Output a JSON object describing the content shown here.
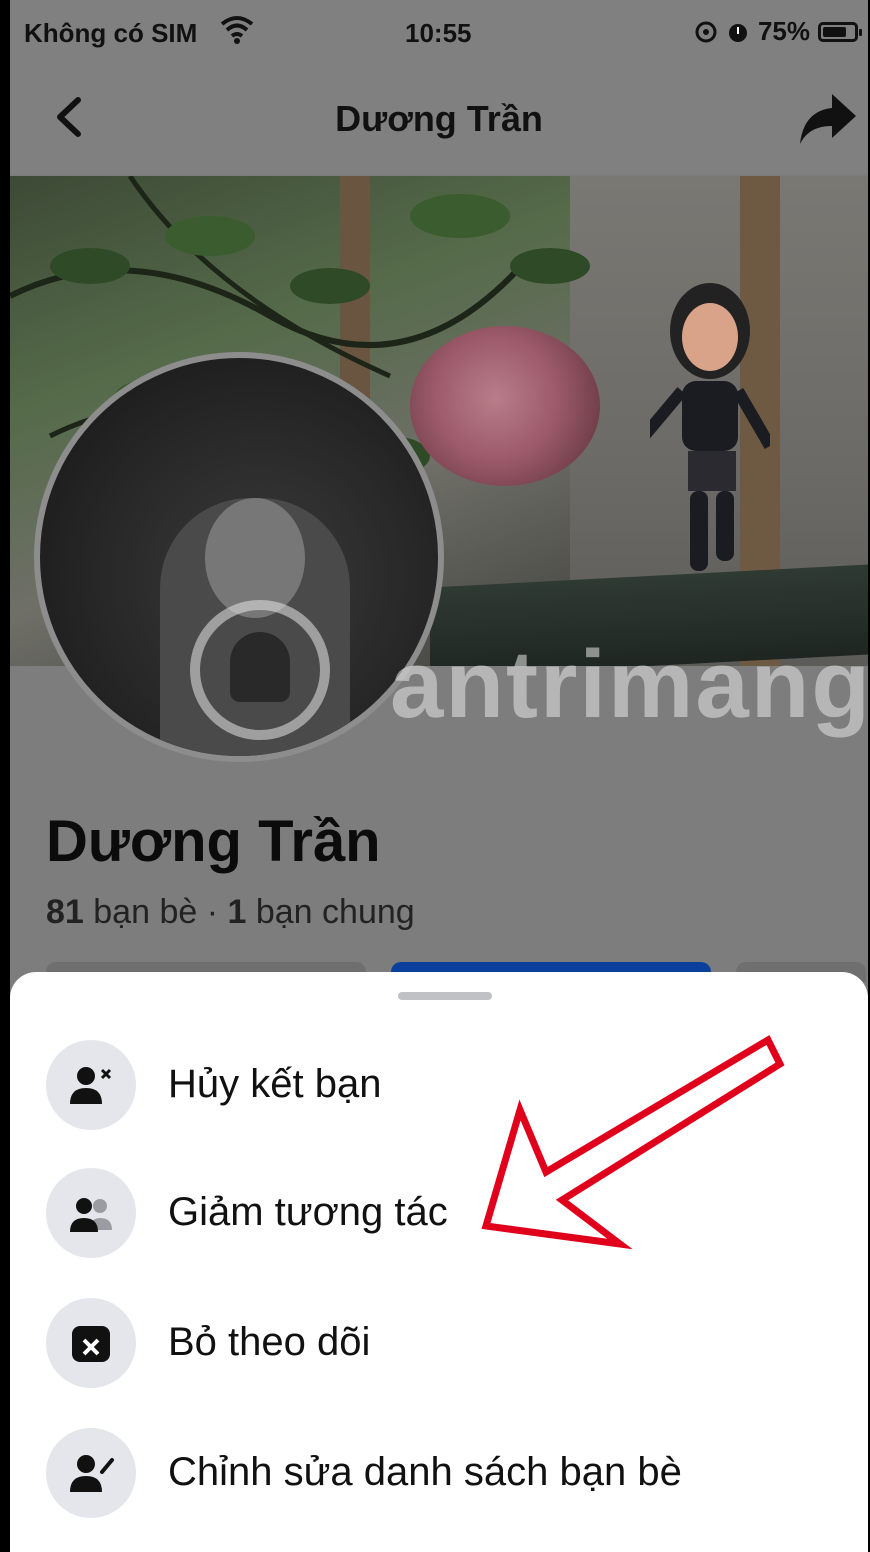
{
  "status_bar": {
    "carrier": "Không có SIM",
    "time": "10:55",
    "battery": "75%",
    "battery_level": 0.75,
    "icons": [
      "wifi-icon",
      "location-icon",
      "alarm-icon",
      "battery-icon"
    ]
  },
  "nav": {
    "title": "Dương Trần",
    "icons": [
      "back-chevron-icon",
      "share-icon"
    ]
  },
  "watermark": {
    "text": "antrimang"
  },
  "profile": {
    "name": "Dương Trần",
    "friends_count": "81",
    "friends_label": " bạn bè",
    "separator": " · ",
    "mutual_count": "1",
    "mutual_label": " bạn chung"
  },
  "sheet": {
    "items": [
      {
        "label": "Hủy kết bạn",
        "icon": "unfriend-icon"
      },
      {
        "label": "Giảm tương tác",
        "icon": "reduce-interaction-icon"
      },
      {
        "label": "Bỏ theo dõi",
        "icon": "unfollow-icon"
      },
      {
        "label": "Chỉnh sửa danh sách bạn bè",
        "icon": "edit-friend-list-icon"
      }
    ]
  },
  "colors": {
    "primary_blue": "#0a3f9c",
    "annotation_arrow": "#e0001b",
    "sheet_icon_bg": "#e4e6eb"
  }
}
